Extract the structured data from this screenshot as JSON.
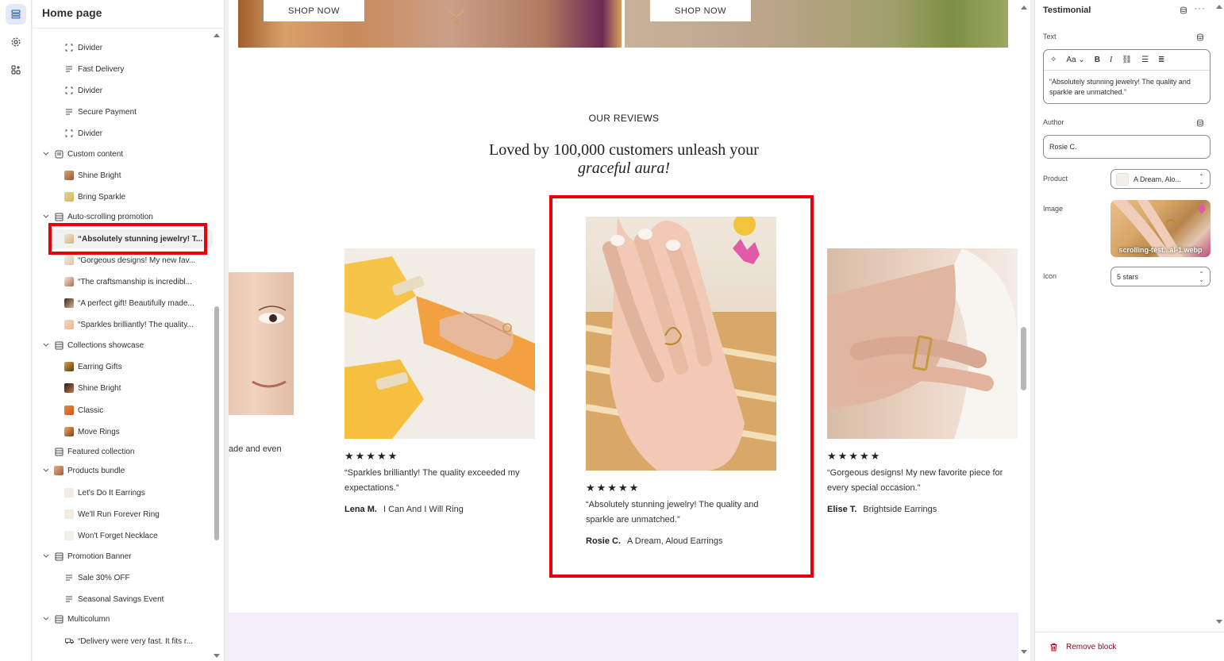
{
  "sidebar": {
    "title": "Home page",
    "items": {
      "divider1": "Divider",
      "fast_delivery": "Fast Delivery",
      "divider2": "Divider",
      "secure_payment": "Secure Payment",
      "divider3": "Divider",
      "custom_content": "Custom content",
      "shine_bright": "Shine Bright",
      "bring_sparkle": "Bring Sparkle",
      "auto_scrolling": "Auto-scrolling promotion",
      "t1": "“Absolutely stunning jewelry! T...",
      "t2": "“Gorgeous designs! My new fav...",
      "t3": "“The craftsmanship is incredibl...",
      "t4": "“A perfect gift! Beautifully made...",
      "t5": "“Sparkles brilliantly! The quality...",
      "collections_showcase": "Collections showcase",
      "earring_gifts": "Earring Gifts",
      "shine_bright2": "Shine Bright",
      "classic": "Classic",
      "move_rings": "Move Rings",
      "featured_collection": "Featured collection",
      "products_bundle": "Products bundle",
      "lets_do_it": "Let's Do It Earrings",
      "well_run": "We'll Run Forever Ring",
      "wont_forget": "Won't Forget Necklace",
      "promotion_banner": "Promotion Banner",
      "sale": "Sale 30% OFF",
      "seasonal": "Seasonal Savings Event",
      "multicolumn": "Multicolumn",
      "delivery": "“Delivery were very fast. It fits r..."
    }
  },
  "preview": {
    "shop_now_1": "SHOP NOW",
    "shop_now_2": "SHOP NOW",
    "eyebrow": "OUR REVIEWS",
    "headline_1": "Loved by 100,000 customers unleash your",
    "headline_2": "graceful aura!",
    "partial_text": "ade and even",
    "cards": [
      {
        "stars": "★★★★★",
        "quote": "“Sparkles brilliantly! The quality exceeded my expectations.”",
        "author": "Lena M.",
        "product": "I Can And I Will Ring"
      },
      {
        "stars": "★★★★★",
        "quote": "“Absolutely stunning jewelry! The quality and sparkle are unmatched.”",
        "author": "Rosie C.",
        "product": "A Dream, Aloud Earrings"
      },
      {
        "stars": "★★★★★",
        "quote": "“Gorgeous designs! My new favorite piece for every special occasion.”",
        "author": "Elise T.",
        "product": "Brightside Earrings"
      }
    ]
  },
  "panel": {
    "title": "Testimonial",
    "text_label": "Text",
    "text_value": "“Absolutely stunning jewelry! The quality and sparkle are unmatched.”",
    "author_label": "Author",
    "author_value": "Rosie C.",
    "product_label": "Product",
    "product_value": "A Dream, Alo...",
    "image_label": "Image",
    "image_caption": "scrolling-test...al-1.webp",
    "icon_label": "Icon",
    "icon_value": "5 stars",
    "remove": "Remove block"
  },
  "colors": {
    "highlight": "#e8000b",
    "accent": "#2c6ecb",
    "danger": "#8e0b21",
    "lavender": "#f3eefb"
  }
}
